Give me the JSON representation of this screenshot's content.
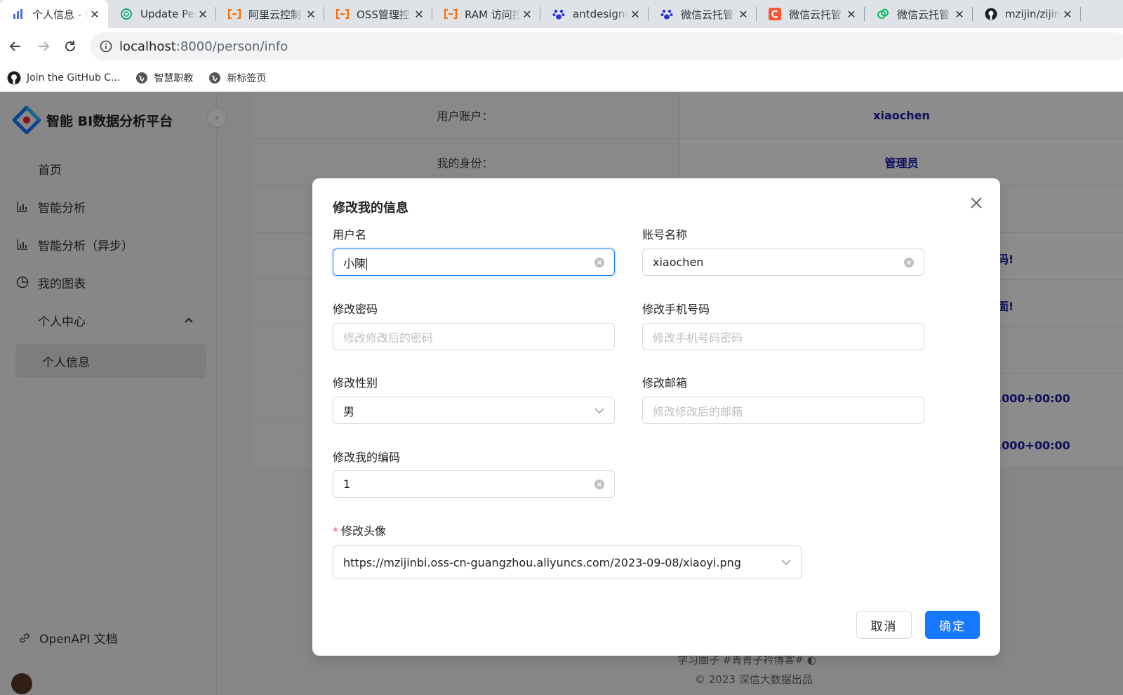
{
  "browser": {
    "tabs": [
      {
        "title": "个人信息 - W",
        "icon": "bar-chart-icon",
        "active": true
      },
      {
        "title": "Update Per",
        "icon": "openai-icon"
      },
      {
        "title": "阿里云控制",
        "icon": "aliyun-icon"
      },
      {
        "title": "OSS管理控",
        "icon": "aliyun-icon"
      },
      {
        "title": "RAM 访问控",
        "icon": "aliyun-icon"
      },
      {
        "title": "antdesignv",
        "icon": "baidu-paw-icon"
      },
      {
        "title": "微信云托管",
        "icon": "baidu-paw-icon"
      },
      {
        "title": "微信云托管",
        "icon": "csdn-icon"
      },
      {
        "title": "微信云托管",
        "icon": "wechat-cloud-icon"
      },
      {
        "title": "mzijin/zijin",
        "icon": "github-icon"
      }
    ],
    "url_host": "localhost",
    "url_rest": ":8000/person/info",
    "bookmarks": [
      {
        "label": "Join the GitHub C...",
        "icon": "github-icon"
      },
      {
        "label": "智慧职教",
        "icon": "globe-icon"
      },
      {
        "label": "新标签页",
        "icon": "globe-icon"
      }
    ]
  },
  "app": {
    "title": "智能 BI数据分析平台",
    "menu": {
      "home": "首页",
      "analysis": "智能分析",
      "analysis_async": "智能分析（异步）",
      "my_charts": "我的图表",
      "personal_center": "个人中心",
      "personal_info": "个人信息",
      "openapi": "OpenAPI 文档"
    },
    "info_rows": [
      {
        "label": "用户账户：",
        "value": "xiaochen"
      },
      {
        "label": "我的身份：",
        "value": "管理员"
      }
    ],
    "partial_values": [
      "码!",
      "面!",
      ".000+00:00",
      ".000+00:00"
    ],
    "footer": "学习圈子  #青青子衿博客#",
    "copyright": "© 2023 深信大数据出品"
  },
  "modal": {
    "title": "修改我的信息",
    "fields": {
      "username": {
        "label": "用户名",
        "value": "小陳"
      },
      "account": {
        "label": "账号名称",
        "value": "xiaochen"
      },
      "password": {
        "label": "修改密码",
        "placeholder": "修改修改后的密码"
      },
      "phone": {
        "label": "修改手机号码",
        "placeholder": "修改手机号码密码"
      },
      "gender": {
        "label": "修改性别",
        "value": "男"
      },
      "email": {
        "label": "修改邮箱",
        "placeholder": "修改修改后的邮箱"
      },
      "code": {
        "label": "修改我的编码",
        "value": "1"
      },
      "avatar": {
        "label": "修改头像",
        "required_mark": "*",
        "value": "https://mzijinbi.oss-cn-guangzhou.aliyuncs.com/2023-09-08/xiaoyi.png"
      }
    },
    "cancel_label": "取消",
    "ok_label": "确定"
  },
  "colors": {
    "primary": "#1677ff",
    "value_text": "#1a1aa6",
    "danger": "#ff4d4f"
  }
}
